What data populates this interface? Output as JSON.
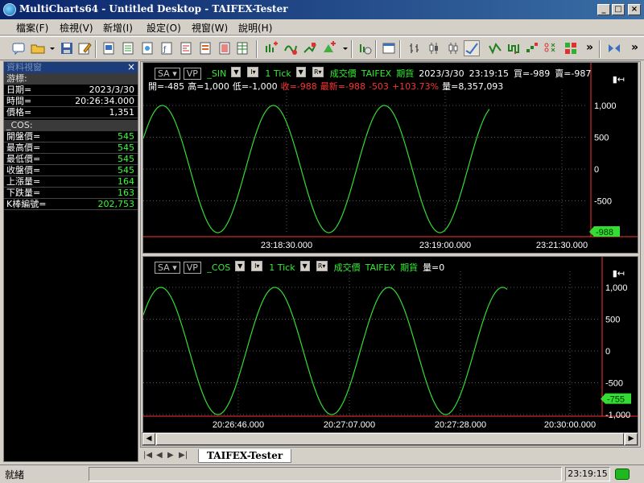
{
  "window": {
    "title": "MultiCharts64 - Untitled Desktop - TAIFEX-Tester",
    "minimize": "_",
    "maximize": "□",
    "close": "×"
  },
  "menu": [
    "檔案(F)",
    "檢視(V)",
    "新增(I)",
    "設定(O)",
    "視窗(W)",
    "說明(H)"
  ],
  "toolbar": {
    "overflow1": "»",
    "overflow2": "»",
    "overflow3": "»"
  },
  "data_window": {
    "title": "資料視窗",
    "close": "×",
    "cursor_section": "游標:",
    "rows1": [
      {
        "k": "日期=",
        "v": "2023/3/30"
      },
      {
        "k": "時間=",
        "v": "20:26:34.000"
      },
      {
        "k": "價格=",
        "v": "1,351"
      }
    ],
    "series_section": "_COS:",
    "rows2": [
      {
        "k": "開盤價=",
        "v": "545"
      },
      {
        "k": "最高價=",
        "v": "545"
      },
      {
        "k": "最低價=",
        "v": "545"
      },
      {
        "k": "收盤價=",
        "v": "545"
      },
      {
        "k": "上漲量=",
        "v": "164"
      },
      {
        "k": "下跌量=",
        "v": "163"
      },
      {
        "k": "K棒編號=",
        "v": "202,753"
      }
    ]
  },
  "chart_top": {
    "sa": "SA",
    "vp": "VP",
    "symbol": "_SIN",
    "interval": "1 Tick",
    "field": "成交價",
    "exchange": "TAIFEX",
    "category": "期貨",
    "date": "2023/3/30",
    "time": "23:19:15",
    "bid": "買=-989",
    "ask": "賣=-987",
    "open": "開=-485",
    "high": "高=1,000",
    "low": "低=-1,000",
    "close": "收=-988",
    "last": "最新=-988",
    "change": "-503",
    "change_pct": "+103.73%",
    "volume": "量=8,357,093",
    "y_ticks": [
      "1,000",
      "500",
      "0",
      "-500"
    ],
    "x_ticks": [
      "23:18:30.000",
      "23:19:00.000",
      "23:21:30.000"
    ],
    "last_price_tag": "-988"
  },
  "chart_bottom": {
    "sa": "SA",
    "vp": "VP",
    "symbol": "_COS",
    "interval": "1 Tick",
    "field": "成交價",
    "exchange": "TAIFEX",
    "category": "期貨",
    "volume": "量=0",
    "y_ticks": [
      "1,000",
      "500",
      "0",
      "-500",
      "-1,000"
    ],
    "x_ticks": [
      "20:26:46.000",
      "20:27:07.000",
      "20:27:28.000",
      "20:30:00.000"
    ],
    "last_price_tag": "-755"
  },
  "tabs": [
    "TAIFEX-Tester"
  ],
  "status": {
    "text": "就緒",
    "time": "23:19:15"
  },
  "colors": {
    "line": "#33dd33",
    "accent_red": "#ff3333",
    "title_bar": "#0a246a"
  }
}
